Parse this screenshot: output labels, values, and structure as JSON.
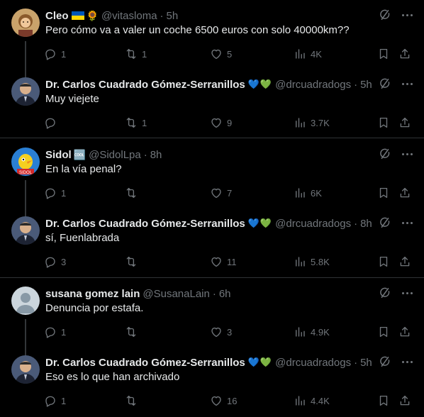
{
  "tweets": [
    {
      "name": "Cleo",
      "emoji": "🌻",
      "handle": "@vitasloma",
      "time": "5h",
      "text": "Pero cómo va a valer un coche 6500 euros con solo 40000km??",
      "replies": "1",
      "retweets": "1",
      "likes": "5",
      "views": "4K",
      "avatar_color": "#c9a36b"
    },
    {
      "name": "Dr. Carlos Cuadrado Gómez-Serranillos",
      "emoji": "💙💚",
      "handle": "@drcuadradogs",
      "time": "5h",
      "text": "Muy viejete",
      "replies": "",
      "retweets": "1",
      "likes": "9",
      "views": "3.7K",
      "avatar_color": "#3b4a6b"
    },
    {
      "name": "Sidol",
      "emoji": "🆒",
      "handle": "@SidolLpa",
      "time": "8h",
      "text": "En la vía penal?",
      "replies": "1",
      "retweets": "",
      "likes": "7",
      "views": "6K",
      "avatar_color": "#2a7fd4"
    },
    {
      "name": "Dr. Carlos Cuadrado Gómez-Serranillos",
      "emoji": "💙💚",
      "handle": "@drcuadradogs",
      "time": "8h",
      "text": "sí, Fuenlabrada",
      "replies": "3",
      "retweets": "",
      "likes": "11",
      "views": "5.8K",
      "avatar_color": "#3b4a6b"
    },
    {
      "name": "susana gomez lain",
      "emoji": "",
      "handle": "@SusanaLain",
      "time": "6h",
      "text": "Denuncia por estafa.",
      "replies": "1",
      "retweets": "",
      "likes": "3",
      "views": "4.9K",
      "avatar_color": "#ccd6dd"
    },
    {
      "name": "Dr. Carlos Cuadrado Gómez-Serranillos",
      "emoji": "💙💚",
      "handle": "@drcuadradogs",
      "time": "5h",
      "text": "Eso es lo que han archivado",
      "replies": "1",
      "retweets": "",
      "likes": "16",
      "views": "4.4K",
      "avatar_color": "#3b4a6b"
    }
  ],
  "separator": "·"
}
